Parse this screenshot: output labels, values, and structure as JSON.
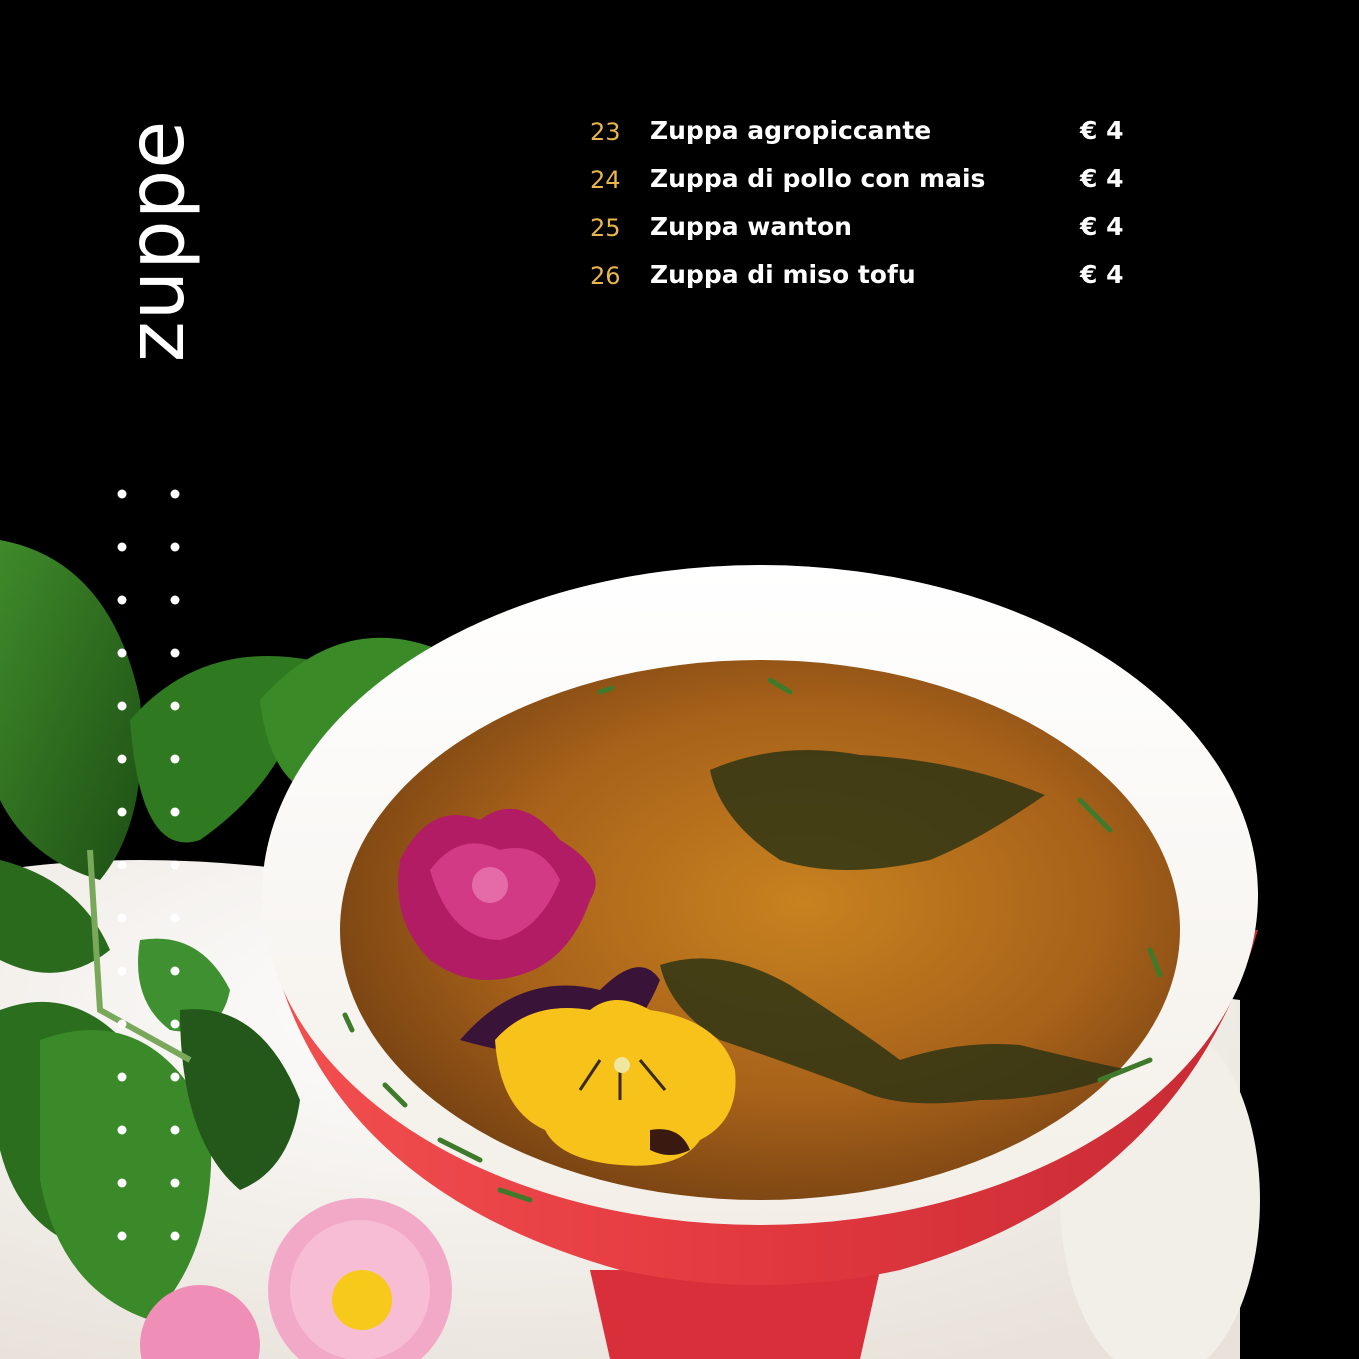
{
  "section": {
    "title": "zuppe"
  },
  "menu": [
    {
      "number": "23",
      "name": "Zuppa agropiccante",
      "price": "€ 4"
    },
    {
      "number": "24",
      "name": "Zuppa di pollo con mais",
      "price": "€ 4"
    },
    {
      "number": "25",
      "name": "Zuppa wanton",
      "price": "€ 4"
    },
    {
      "number": "26",
      "name": "Zuppa di miso tofu",
      "price": "€ 4"
    }
  ],
  "colors": {
    "background": "#000000",
    "accent_number": "#e9b64a",
    "text": "#ffffff",
    "bowl_red": "#e2383f",
    "broth": "#b9721c"
  },
  "photo": {
    "subject": "soup-bowl-with-edible-flowers"
  }
}
